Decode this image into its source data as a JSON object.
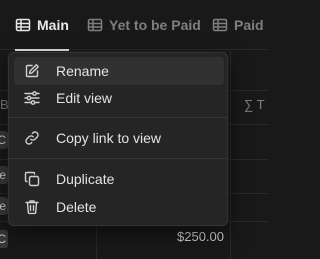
{
  "tabs": [
    {
      "label": "Main",
      "icon": "table-icon",
      "active": true
    },
    {
      "label": "Yet to be Paid",
      "icon": "table-icon",
      "active": false
    },
    {
      "label": "Paid",
      "icon": "table-icon",
      "active": false
    }
  ],
  "table": {
    "left_header": "B",
    "right_header": "∑ T",
    "row_tags": [
      "C",
      "le",
      "le",
      "C"
    ],
    "amount": "$250.00"
  },
  "menu": {
    "items": [
      {
        "label": "Rename",
        "icon": "pencil-icon"
      },
      {
        "label": "Edit view",
        "icon": "sliders-icon"
      },
      {
        "label": "Copy link to view",
        "icon": "link-icon"
      },
      {
        "label": "Duplicate",
        "icon": "duplicate-icon"
      },
      {
        "label": "Delete",
        "icon": "trash-icon"
      }
    ]
  },
  "colors": {
    "background": "#191919",
    "menu": "#252525",
    "hover": "#313131",
    "text": "#e3e3e3",
    "muted": "#7f7f7f"
  }
}
